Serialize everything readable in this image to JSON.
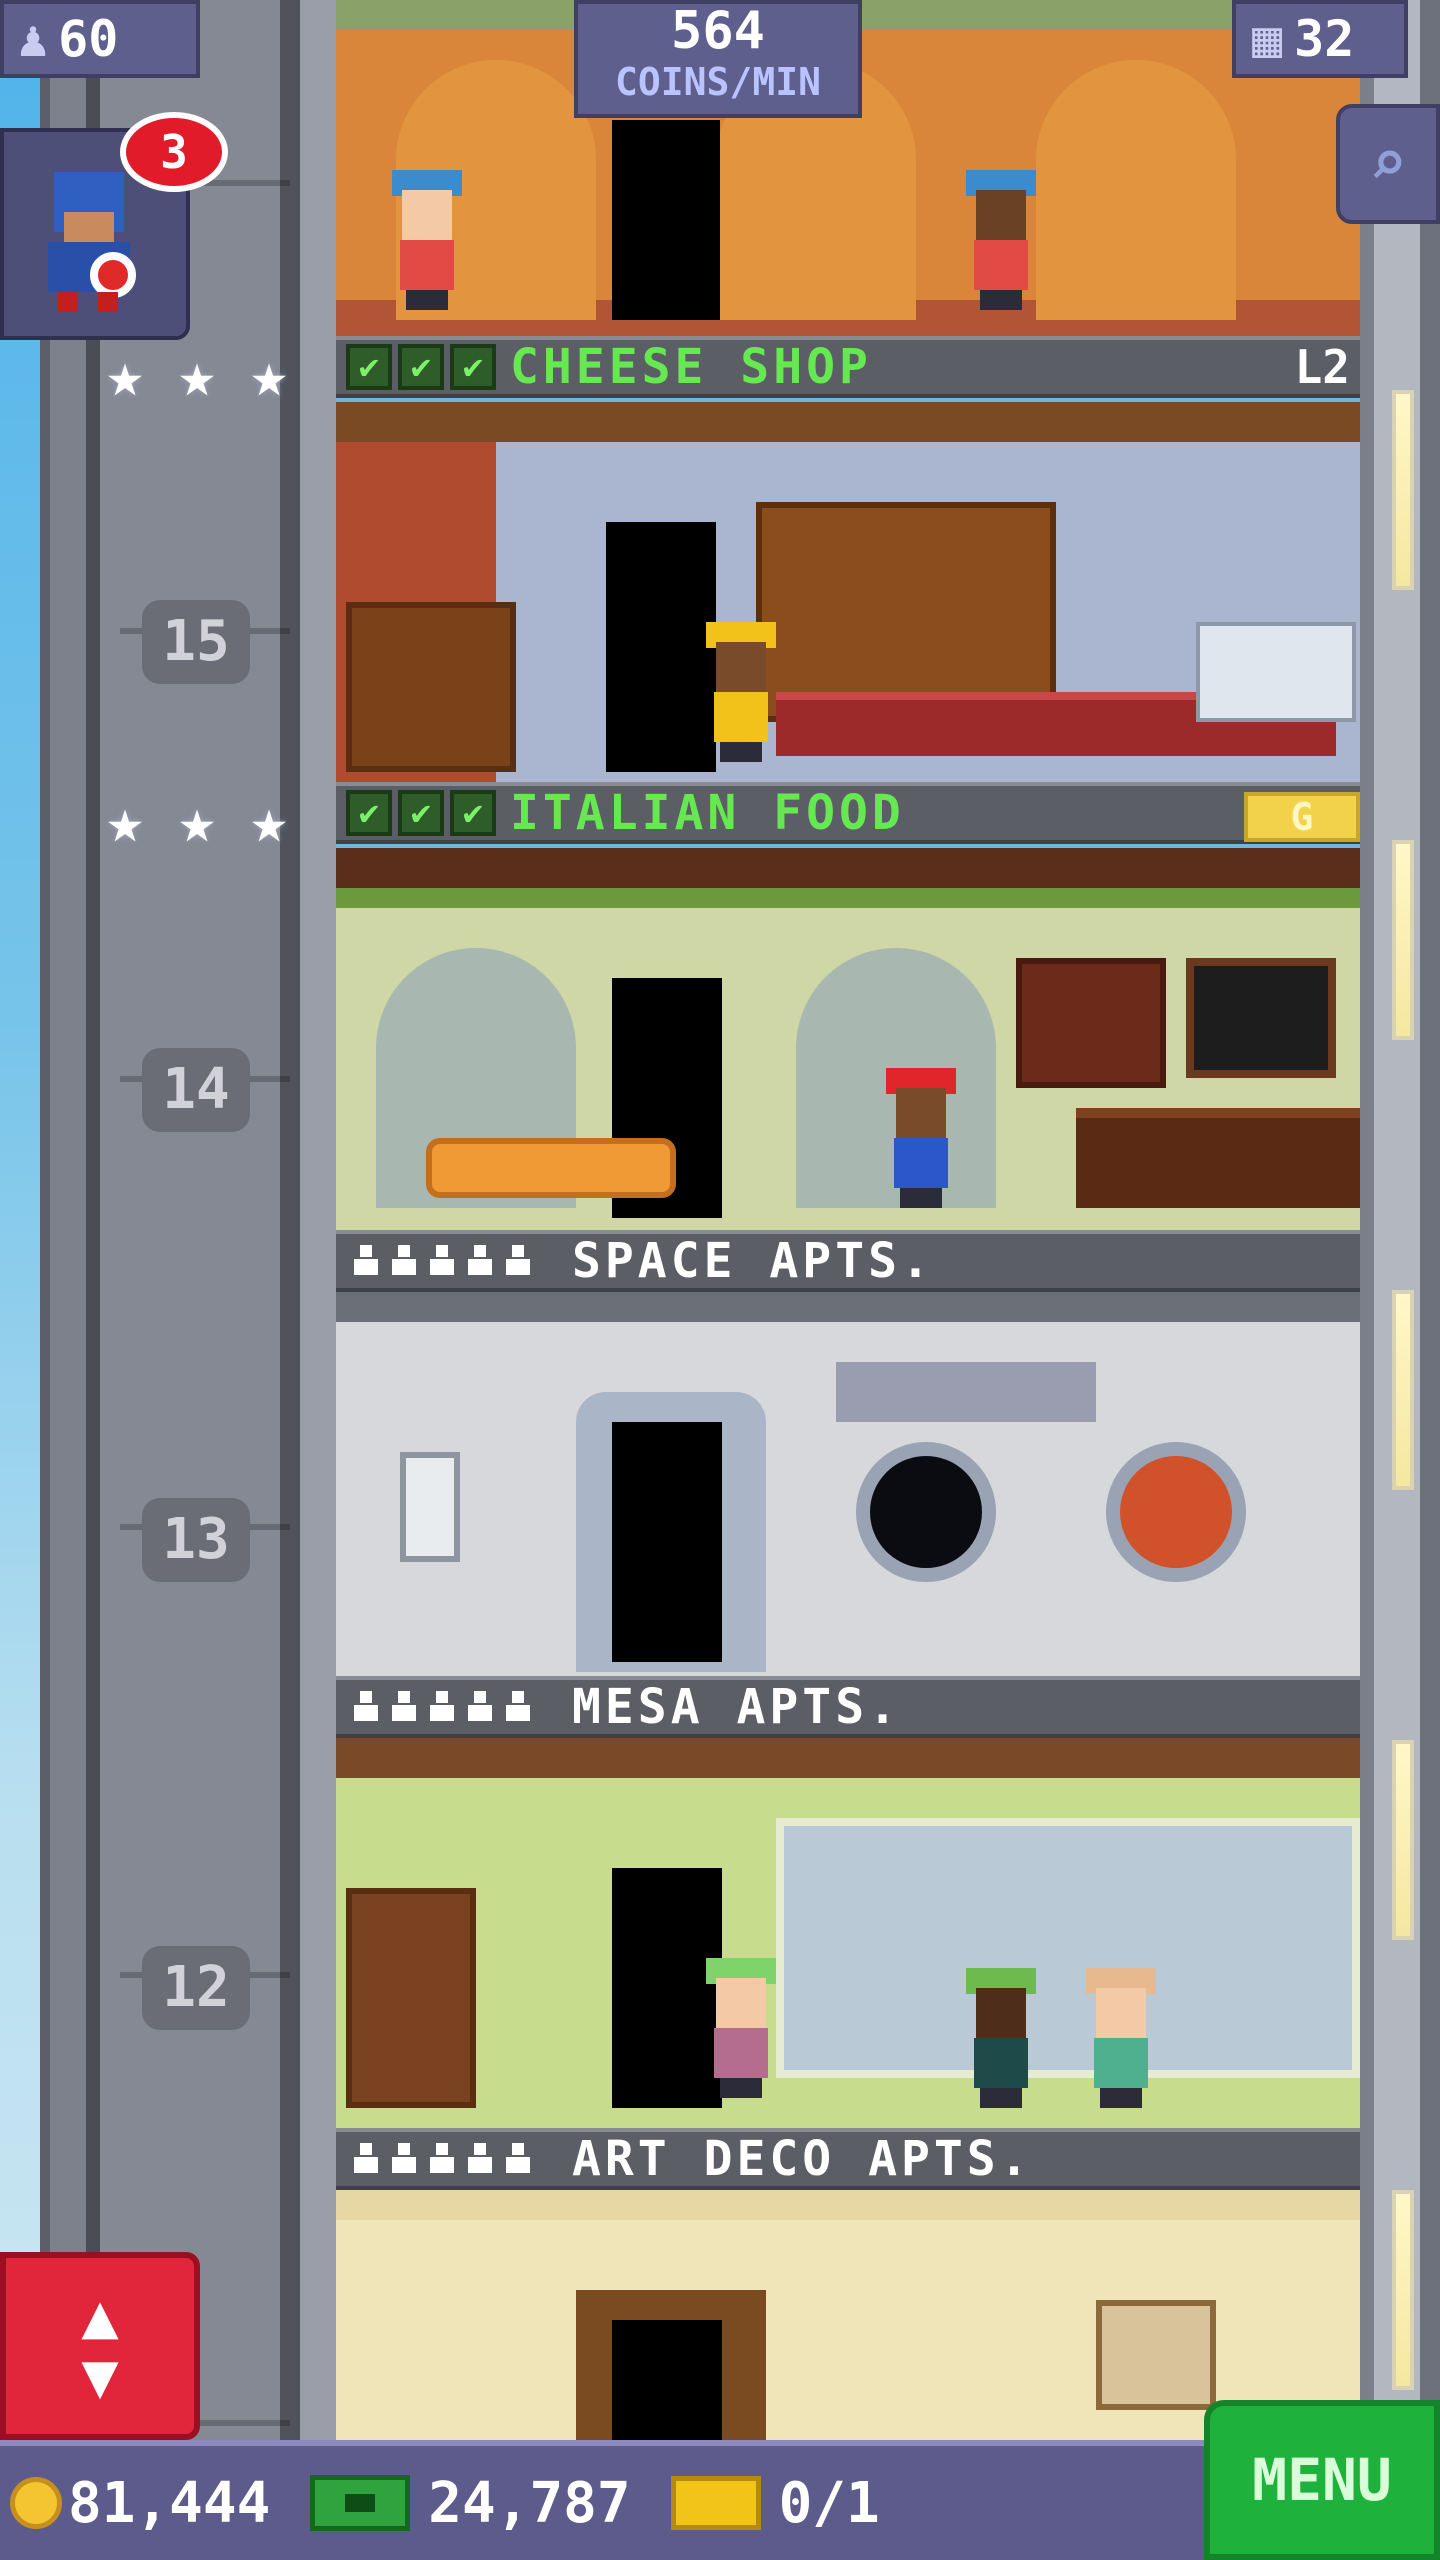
{
  "hud": {
    "population": "60",
    "coins_per_min_value": "564",
    "coins_per_min_label": "COINS/MIN",
    "floor_count": "32",
    "vip_count": "3"
  },
  "floors": {
    "cheese_shop": {
      "name": "CHEESE SHOP",
      "level": "L2"
    },
    "italian_food": {
      "name": "ITALIAN FOOD",
      "badge": "G"
    },
    "space_apts": {
      "name": "SPACE APTS."
    },
    "mesa_apts": {
      "name": "MESA APTS."
    },
    "art_deco_apts": {
      "name": "ART DECO APTS."
    }
  },
  "floor_numbers": {
    "f15": "15",
    "f14": "14",
    "f13": "13",
    "f12": "12"
  },
  "currency": {
    "coins": "81,444",
    "bux": "24,787",
    "tickets": "0/1"
  },
  "menu": {
    "label": "MENU"
  },
  "icons": {
    "population": "person-icon",
    "floors": "building-icon",
    "search": "magnifier-icon",
    "elevator": "up-down-arrows-icon",
    "coin": "coin-icon",
    "bux": "bux-icon",
    "ticket": "ticket-icon"
  },
  "colors": {
    "business_name": "#66e851",
    "hud_panel": "#5f5f8e",
    "menu_button": "#1eb13b",
    "elevator_button": "#e1253b",
    "vip_badge": "#e21b2a"
  }
}
